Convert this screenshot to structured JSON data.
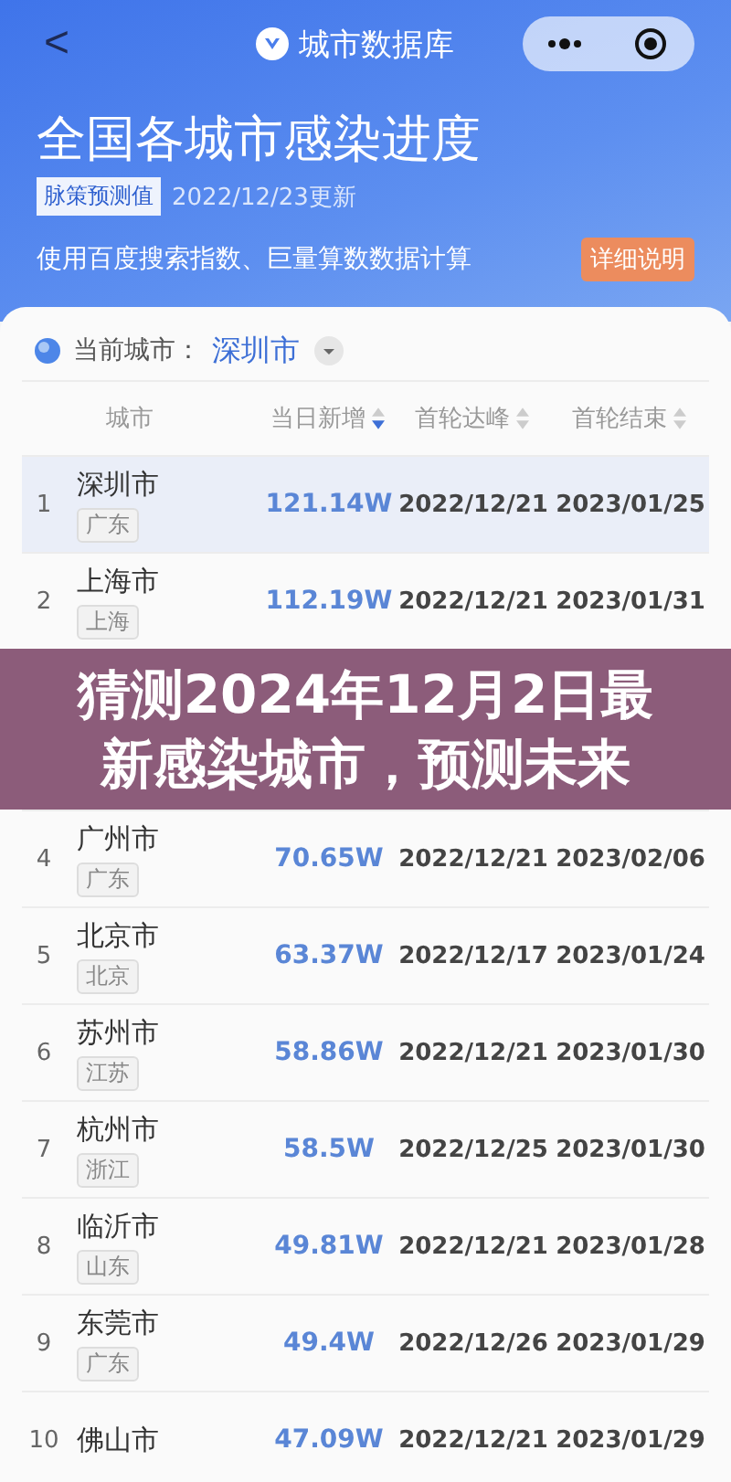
{
  "nav": {
    "back": "<",
    "title": "城市数据库"
  },
  "header": {
    "title": "全国各城市感染进度",
    "badge": "脉策预测值",
    "updated": "2022/12/23更新",
    "description": "使用百度搜索指数、巨量算数数据计算",
    "detail_button": "详细说明"
  },
  "city_picker": {
    "label": "当前城市：",
    "value": "深圳市"
  },
  "table": {
    "columns": [
      {
        "label": "城市"
      },
      {
        "label": "当日新增",
        "sorted": true
      },
      {
        "label": "首轮达峰",
        "sorted": false
      },
      {
        "label": "首轮结束",
        "sorted": false
      }
    ],
    "rows": [
      {
        "rank": "1",
        "city": "深圳市",
        "province": "广东",
        "new": "121.14W",
        "peak": "2022/12/21",
        "end": "2023/01/25",
        "selected": true
      },
      {
        "rank": "2",
        "city": "上海市",
        "province": "上海",
        "new": "112.19W",
        "peak": "2022/12/21",
        "end": "2023/01/31",
        "selected": false
      },
      {
        "rank": "4",
        "city": "广州市",
        "province": "广东",
        "new": "70.65W",
        "peak": "2022/12/21",
        "end": "2023/02/06",
        "selected": false
      },
      {
        "rank": "5",
        "city": "北京市",
        "province": "北京",
        "new": "63.37W",
        "peak": "2022/12/17",
        "end": "2023/01/24",
        "selected": false
      },
      {
        "rank": "6",
        "city": "苏州市",
        "province": "江苏",
        "new": "58.86W",
        "peak": "2022/12/21",
        "end": "2023/01/30",
        "selected": false
      },
      {
        "rank": "7",
        "city": "杭州市",
        "province": "浙江",
        "new": "58.5W",
        "peak": "2022/12/25",
        "end": "2023/01/30",
        "selected": false
      },
      {
        "rank": "8",
        "city": "临沂市",
        "province": "山东",
        "new": "49.81W",
        "peak": "2022/12/21",
        "end": "2023/01/28",
        "selected": false
      },
      {
        "rank": "9",
        "city": "东莞市",
        "province": "广东",
        "new": "49.4W",
        "peak": "2022/12/26",
        "end": "2023/01/29",
        "selected": false
      },
      {
        "rank": "10",
        "city": "佛山市",
        "new": "47.09W",
        "peak": "2022/12/21",
        "end": "2023/01/29",
        "selected": false
      }
    ]
  },
  "banner": {
    "lines": [
      "猜测2024年12月2日最",
      "新感染城市，预测未来"
    ]
  }
}
